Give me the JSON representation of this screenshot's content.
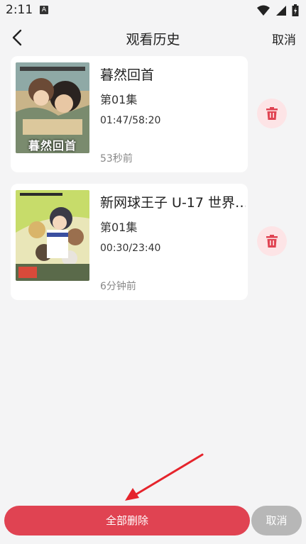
{
  "status_bar": {
    "time": "2:11",
    "notification_badge": "A"
  },
  "header": {
    "title": "观看历史",
    "cancel_label": "取消"
  },
  "history": [
    {
      "title": "暮然回首",
      "episode": "第01集",
      "progress": "01:47/58:20",
      "watched_ago": "53秒前",
      "poster_caption": "暮然回首"
    },
    {
      "title": "新网球王子 U-17 世界…",
      "episode": "第01集",
      "progress": "00:30/23:40",
      "watched_ago": "6分钟前"
    }
  ],
  "footer": {
    "delete_all_label": "全部删除",
    "cancel_label": "取消"
  },
  "colors": {
    "accent": "#e04352",
    "delete_bg": "#fde4e6",
    "cancel_bg": "#b7b7b7",
    "page_bg": "#f4f4f5"
  },
  "icons": {
    "back": "chevron-left-icon",
    "delete": "trash-icon",
    "wifi": "wifi-icon",
    "signal": "signal-icon",
    "battery": "battery-icon"
  }
}
